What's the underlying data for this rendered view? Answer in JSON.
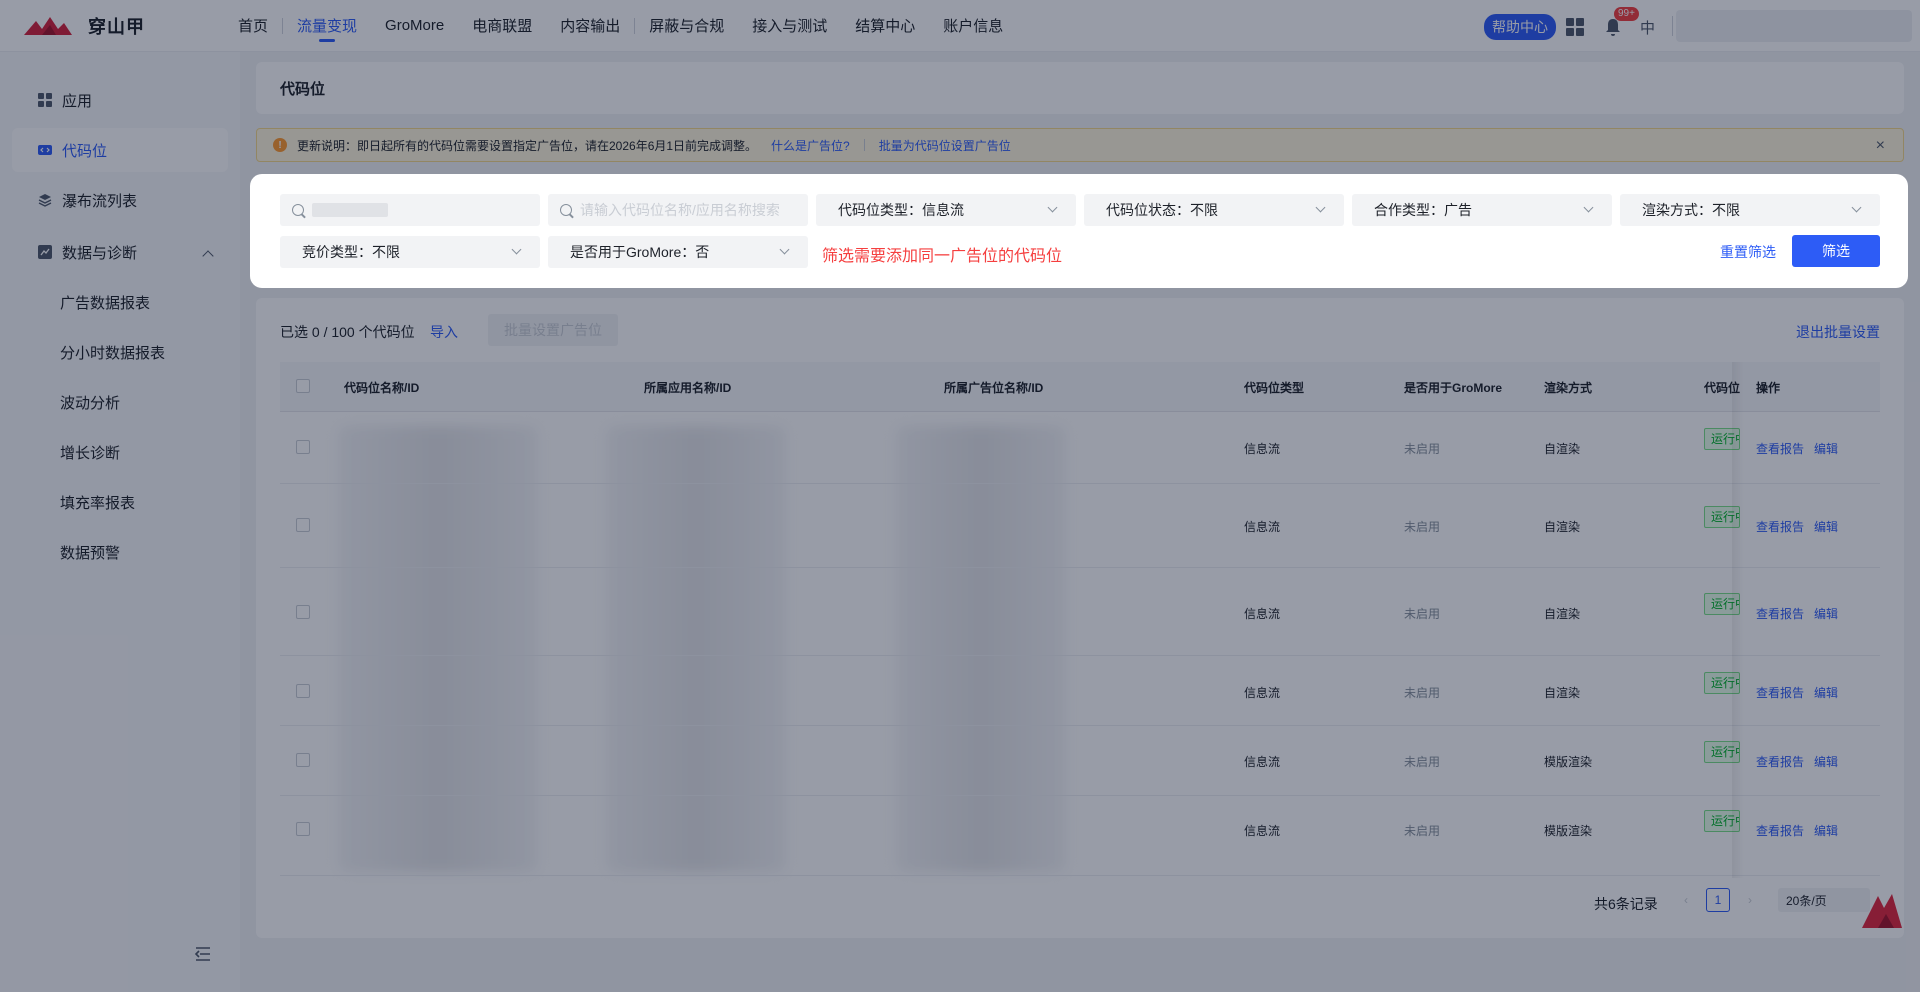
{
  "brand": {
    "name": "穿山甲",
    "color": "#2d5cf6"
  },
  "nav": [
    "首页",
    "流量变现",
    "GroMore",
    "电商联盟",
    "内容输出",
    "屏蔽与合规",
    "接入与测试",
    "结算中心",
    "账户信息"
  ],
  "header": {
    "help": "帮助中心",
    "badge": "99+",
    "lang": "中"
  },
  "sidebar": {
    "items": [
      "应用",
      "代码位",
      "瀑布流列表",
      "数据与诊断"
    ],
    "sub": [
      "广告数据报表",
      "分小时数据报表",
      "波动分析",
      "增长诊断",
      "填充率报表",
      "数据预警"
    ]
  },
  "page": {
    "title": "代码位",
    "notice": "更新说明：即日起所有的代码位需要设置指定广告位，请在2026年6月1日前完成调整。",
    "notice_link1": "什么是广告位?",
    "notice_link2": "批量为代码位设置广告位"
  },
  "filters": {
    "search_placeholder": "请输入代码位名称/应用名称搜索",
    "type": "代码位类型：信息流",
    "status": "代码位状态：不限",
    "coop": "合作类型：广告",
    "render": "渲染方式：不限",
    "bid": "竞价类型：不限",
    "gromore": "是否用于GroMore：否",
    "hint": "筛选需要添加同一广告位的代码位",
    "reset": "重置筛选",
    "submit": "筛选"
  },
  "table": {
    "selected": "已选 0 / 100 个代码位",
    "import": "导入",
    "batch": "批量设置广告位",
    "exit": "退出批量设置",
    "headers": [
      "代码位名称/ID",
      "所属应用名称/ID",
      "所属广告位名称/ID",
      "代码位类型",
      "是否用于GroMore",
      "渲染方式",
      "代码位",
      "操作"
    ],
    "rows": [
      {
        "type": "信息流",
        "gromore": "未启用",
        "render": "自渲染",
        "status": "运行中"
      },
      {
        "type": "信息流",
        "gromore": "未启用",
        "render": "自渲染",
        "status": "运行中"
      },
      {
        "type": "信息流",
        "gromore": "未启用",
        "render": "自渲染",
        "status": "运行中"
      },
      {
        "type": "信息流",
        "gromore": "未启用",
        "render": "自渲染",
        "status": "运行中"
      },
      {
        "type": "信息流",
        "gromore": "未启用",
        "render": "模版渲染",
        "status": "运行中"
      },
      {
        "type": "信息流",
        "gromore": "未启用",
        "render": "模版渲染",
        "status": "运行中"
      }
    ],
    "op_view": "查看报告",
    "op_edit": "编辑"
  },
  "pagination": {
    "total": "共6条记录",
    "current": "1",
    "size": "20条/页",
    "prev": "‹",
    "next": "›"
  }
}
